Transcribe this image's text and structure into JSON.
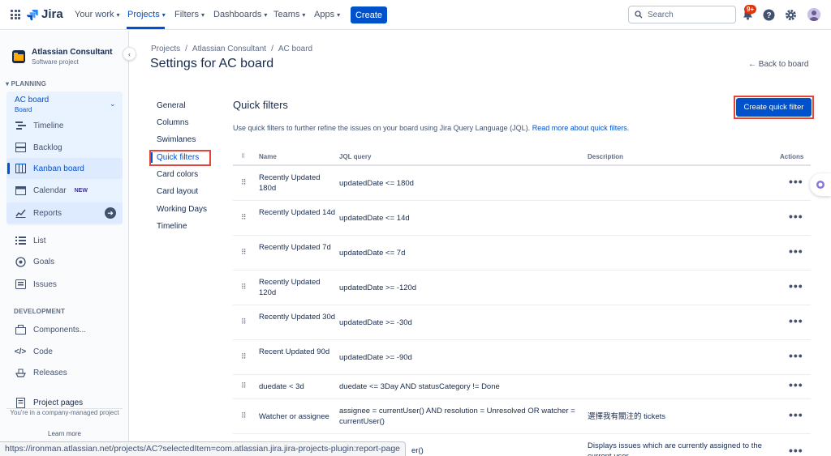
{
  "topnav": {
    "logo": "Jira",
    "items": [
      {
        "label": "Your work"
      },
      {
        "label": "Projects"
      },
      {
        "label": "Filters"
      },
      {
        "label": "Dashboards"
      },
      {
        "label": "Teams"
      },
      {
        "label": "Apps"
      }
    ],
    "create": "Create",
    "search_placeholder": "Search",
    "notifications_badge": "9+"
  },
  "sidebar": {
    "project_name": "Atlassian Consultant",
    "project_type": "Software project",
    "planning_label": "PLANNING",
    "board_name": "AC board",
    "board_sub": "Board",
    "planning_items": [
      {
        "label": "Timeline"
      },
      {
        "label": "Backlog"
      },
      {
        "label": "Kanban board"
      },
      {
        "label": "Calendar",
        "tag": "NEW"
      },
      {
        "label": "Reports"
      }
    ],
    "other_items": [
      {
        "label": "List"
      },
      {
        "label": "Goals"
      },
      {
        "label": "Issues"
      }
    ],
    "development_label": "DEVELOPMENT",
    "dev_items": [
      {
        "label": "Components..."
      },
      {
        "label": "Code"
      },
      {
        "label": "Releases"
      }
    ],
    "project_pages": "Project pages",
    "footer": "You're in a company-managed project",
    "learn_more": "Learn more"
  },
  "main": {
    "breadcrumb": [
      "Projects",
      "/",
      "Atlassian Consultant",
      "/",
      "AC board"
    ],
    "title": "Settings for AC board",
    "back_link": "← Back to board",
    "settings_nav": [
      "General",
      "Columns",
      "Swimlanes",
      "Quick filters",
      "Card colors",
      "Card layout",
      "Working Days",
      "Timeline"
    ],
    "qf_title": "Quick filters",
    "qf_desc": "Use quick filters to further refine the issues on your board using Jira Query Language (JQL).",
    "qf_link": "Read more about quick filters.",
    "create_quick_filter": "Create quick filter",
    "table_headers": {
      "name": "Name",
      "jql": "JQL query",
      "description": "Description",
      "actions": "Actions"
    },
    "rows": [
      {
        "name": "Recently Updated 180d",
        "jql": "updatedDate <= 180d",
        "desc": ""
      },
      {
        "name": "Recently Updated 14d",
        "jql": "updatedDate <= 14d",
        "desc": ""
      },
      {
        "name": "Recently Updated 7d",
        "jql": "updatedDate <= 7d",
        "desc": ""
      },
      {
        "name": "Recently Updated 120d",
        "jql": "updatedDate >= -120d",
        "desc": ""
      },
      {
        "name": "Recently Updated 30d",
        "jql": "updatedDate >= -30d",
        "desc": ""
      },
      {
        "name": "Recent Updated 90d",
        "jql": "updatedDate >= -90d",
        "desc": ""
      },
      {
        "name": "duedate < 3d",
        "jql": "duedate <= 3Day AND statusCategory != Done",
        "desc": ""
      },
      {
        "name": "Watcher or assignee",
        "jql": "assignee = currentUser() AND resolution = Unresolved OR watcher = currentUser()",
        "desc": "選擇我有關注的 tickets"
      },
      {
        "name": "",
        "jql": "er()",
        "desc": "Displays issues which are currently assigned to the current user"
      }
    ]
  },
  "statusbar": "https://ironman.atlassian.net/projects/AC?selectedItem=com.atlassian.jira.jira-projects-plugin:report-page"
}
